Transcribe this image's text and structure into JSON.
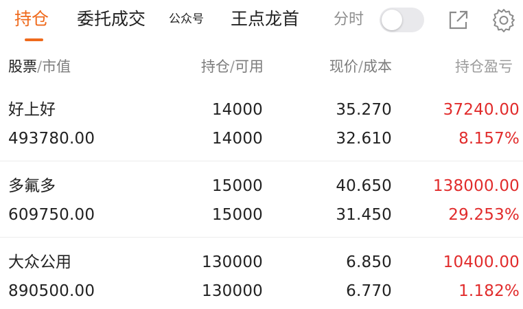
{
  "tabs": [
    {
      "label": "持仓",
      "active": true
    },
    {
      "label": "委托成交",
      "active": false
    },
    {
      "label": "公众号",
      "active": false
    },
    {
      "label": "王点龙首",
      "active": false
    }
  ],
  "toggle": {
    "label": "分时",
    "on": false
  },
  "icons": {
    "share": "external-link-icon",
    "settings": "gear-icon"
  },
  "colors": {
    "accent": "#ef6a1c",
    "profit": "#e12b2b",
    "text": "#222222",
    "muted": "#7c7c7c"
  },
  "header": {
    "stock": "股票",
    "sep": "/",
    "market_value": "市值",
    "position": "持仓",
    "available": "可用",
    "price": "现价",
    "cost": "成本",
    "pnl": "持仓盈亏"
  },
  "holdings": [
    {
      "name": "好上好",
      "market_value": "493780.00",
      "position": "14000",
      "available": "14000",
      "price": "35.270",
      "cost": "32.610",
      "pnl": "37240.00",
      "pnl_pct": "8.157%"
    },
    {
      "name": "多氟多",
      "market_value": "609750.00",
      "position": "15000",
      "available": "15000",
      "price": "40.650",
      "cost": "31.450",
      "pnl": "138000.00",
      "pnl_pct": "29.253%"
    },
    {
      "name": "大众公用",
      "market_value": "890500.00",
      "position": "130000",
      "available": "130000",
      "price": "6.850",
      "cost": "6.770",
      "pnl": "10400.00",
      "pnl_pct": "1.182%"
    }
  ]
}
